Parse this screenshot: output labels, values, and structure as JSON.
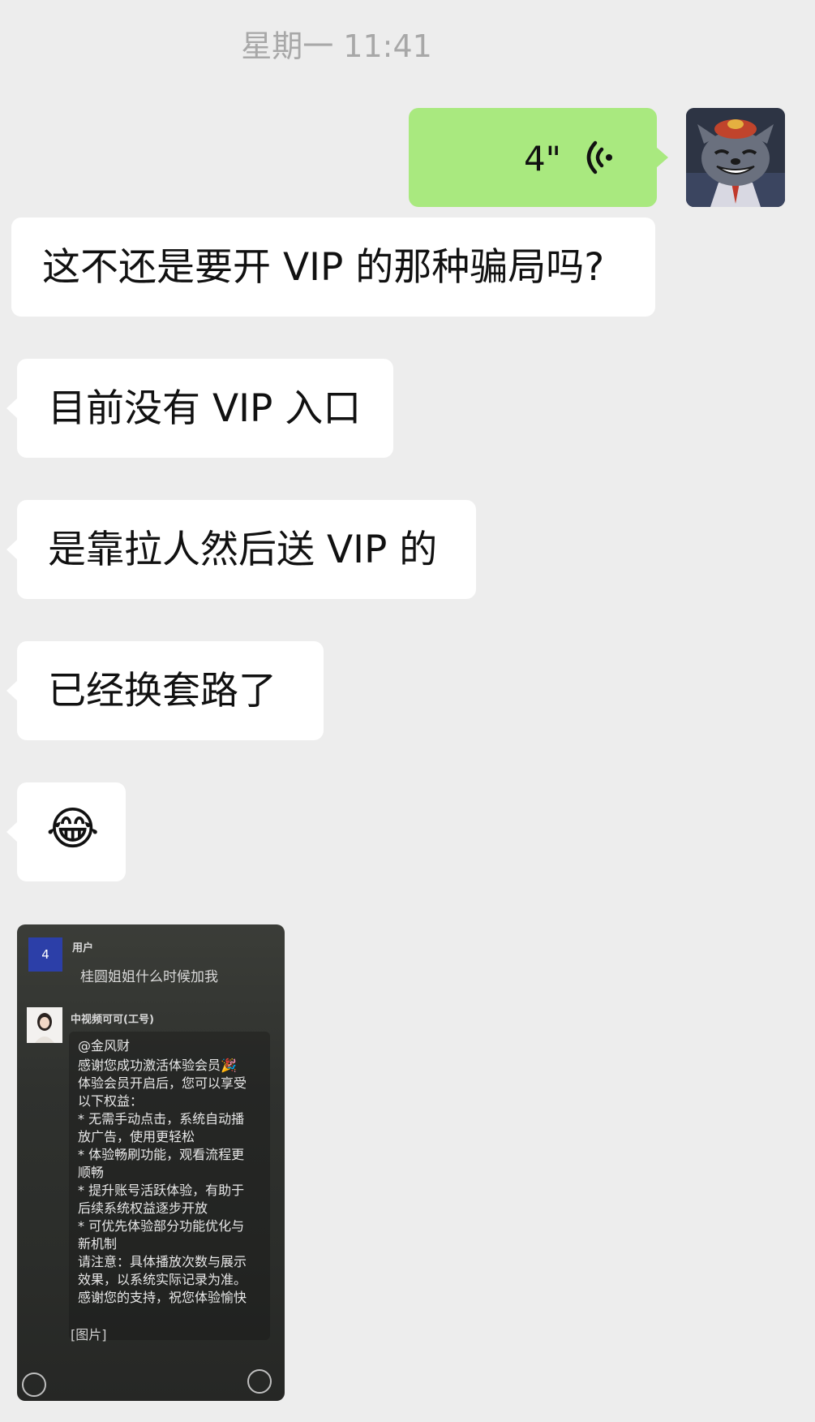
{
  "timestamp": "星期一 11:41",
  "voice_message": {
    "duration": "4\"",
    "icon": "voice-wave-icon",
    "bubble_color": "#a9e97f"
  },
  "self_avatar": {
    "icon": "cartoon-wolf-avatar"
  },
  "messages": [
    {
      "text": "这不还是要开 VIP 的那种骗局吗?"
    },
    {
      "text": "目前没有 VIP 入口"
    },
    {
      "text": "是靠拉人然后送 VIP 的"
    },
    {
      "text": "已经换套路了"
    }
  ],
  "emoji_message": {
    "emoji": "😂"
  },
  "screenshot_image": {
    "badge": "4",
    "user_label": "用户",
    "user_message": "桂圆姐姐什么时候加我",
    "sender_name": "中视频可可(工号)",
    "lines": [
      "@金风财",
      "感谢您成功激活体验会员🎉",
      "体验会员开启后，您可以享受",
      "以下权益：",
      "* 无需手动点击，系统自动播",
      "放广告，使用更轻松",
      "* 体验畅刷功能，观看流程更",
      "顺畅",
      "* 提升账号活跃体验，有助于",
      "后续系统权益逐步开放",
      "* 可优先体验部分功能优化与",
      "新机制",
      "请注意：具体播放次数与展示",
      "效果，以系统实际记录为准。",
      "感谢您的支持，祝您体验愉快"
    ],
    "image_tag": "[图片]"
  }
}
